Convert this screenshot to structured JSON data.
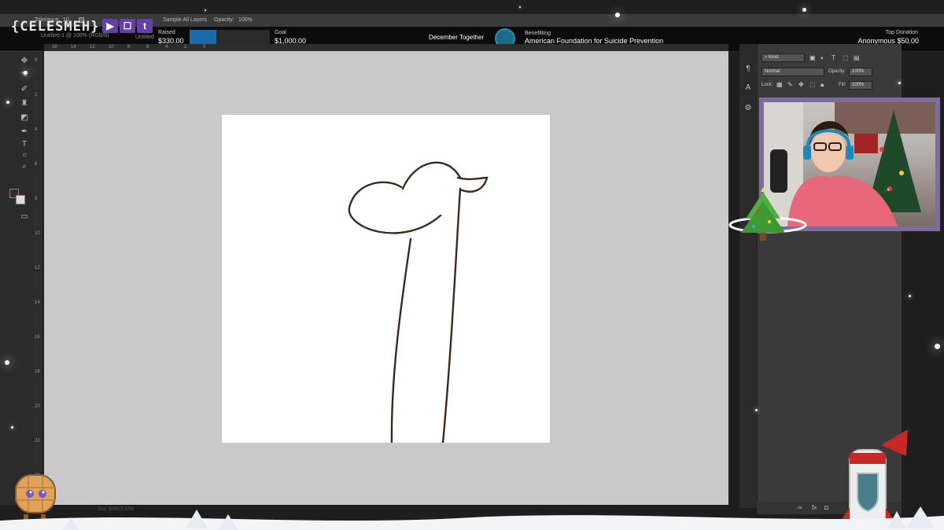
{
  "photoshop": {
    "options_bar": {
      "tolerance_label": "Tolerance:",
      "tolerance_value": "10",
      "sample_all_layers": "Sample All Layers",
      "opacity_label": "Opacity:",
      "opacity_value": "100%"
    },
    "document_tab": "Untitled-1 @ 100% (RGB/8)",
    "document_short": "Untitled",
    "top_ruler_ticks": [
      "16",
      "14",
      "12",
      "10",
      "8",
      "6",
      "4",
      "2",
      "0"
    ],
    "left_ruler_ticks": [
      "0",
      "2",
      "4",
      "6",
      "8",
      "10",
      "12",
      "14",
      "16",
      "18",
      "20",
      "22",
      "24"
    ],
    "status_text": "Doc: 900K/3.83M",
    "layers_panel": {
      "kind_filter": "Kind",
      "blend_mode": "Normal",
      "opacity_label": "Opacity:",
      "opacity_value": "100%",
      "lock_label": "Lock:",
      "fill_label": "Fill:",
      "fill_value": "100%"
    },
    "colors": {
      "foreground": "#3b2a20",
      "background": "#dddddd",
      "stroke": "#3b2a20"
    }
  },
  "stream_overlay": {
    "logo_text": "{CELESMEH}",
    "social_icons": [
      "youtube-icon",
      "twitch-icon",
      "tumblr-icon"
    ],
    "raised_label": "Raised",
    "raised_value": "$330.00",
    "goal_label": "Goal",
    "goal_value": "$1,000.00",
    "progress_fraction": 0.33,
    "event_title": "December Together",
    "benefitting_label": "Benefitting",
    "foundation_name": "American Foundation for Suicide Prevention",
    "top_donation_label": "Top Donation",
    "top_donation_value": "Anonymous $50.00",
    "accent_color": "#6441a5"
  }
}
